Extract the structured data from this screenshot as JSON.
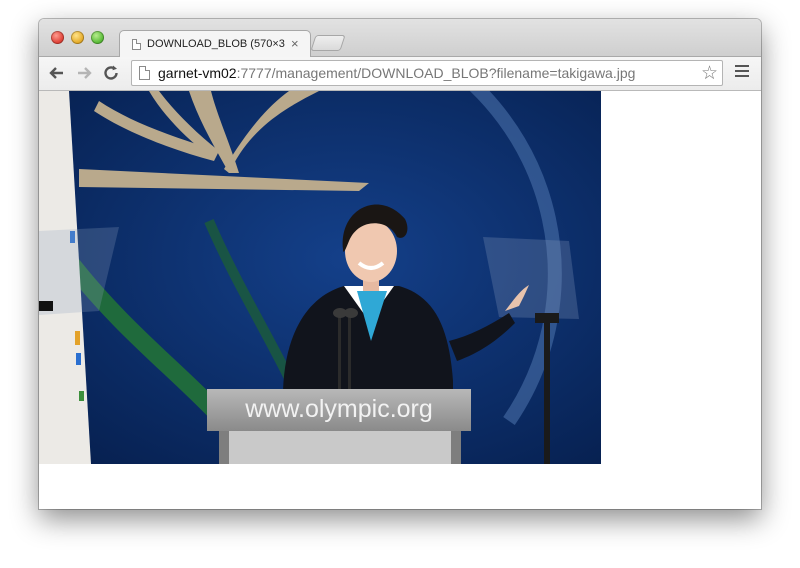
{
  "browser": {
    "tab": {
      "title": "DOWNLOAD_BLOB (570×3",
      "close_glyph": "×"
    },
    "address_bar": {
      "host": "garnet-vm02",
      "rest": ":7777/management/DOWNLOAD_BLOB?filename=takigawa.jpg"
    },
    "icons": {
      "back": "back-arrow-icon",
      "forward": "forward-arrow-icon",
      "reload": "reload-icon",
      "page": "page-icon",
      "star": "bookmark-star-icon",
      "menu": "hamburger-menu-icon"
    }
  },
  "image": {
    "podium_text": "www.olympic.org",
    "colors": {
      "backdrop": "#0a2f6c",
      "emblem": "#b9a98c",
      "podium": "#9a9a9a"
    }
  }
}
